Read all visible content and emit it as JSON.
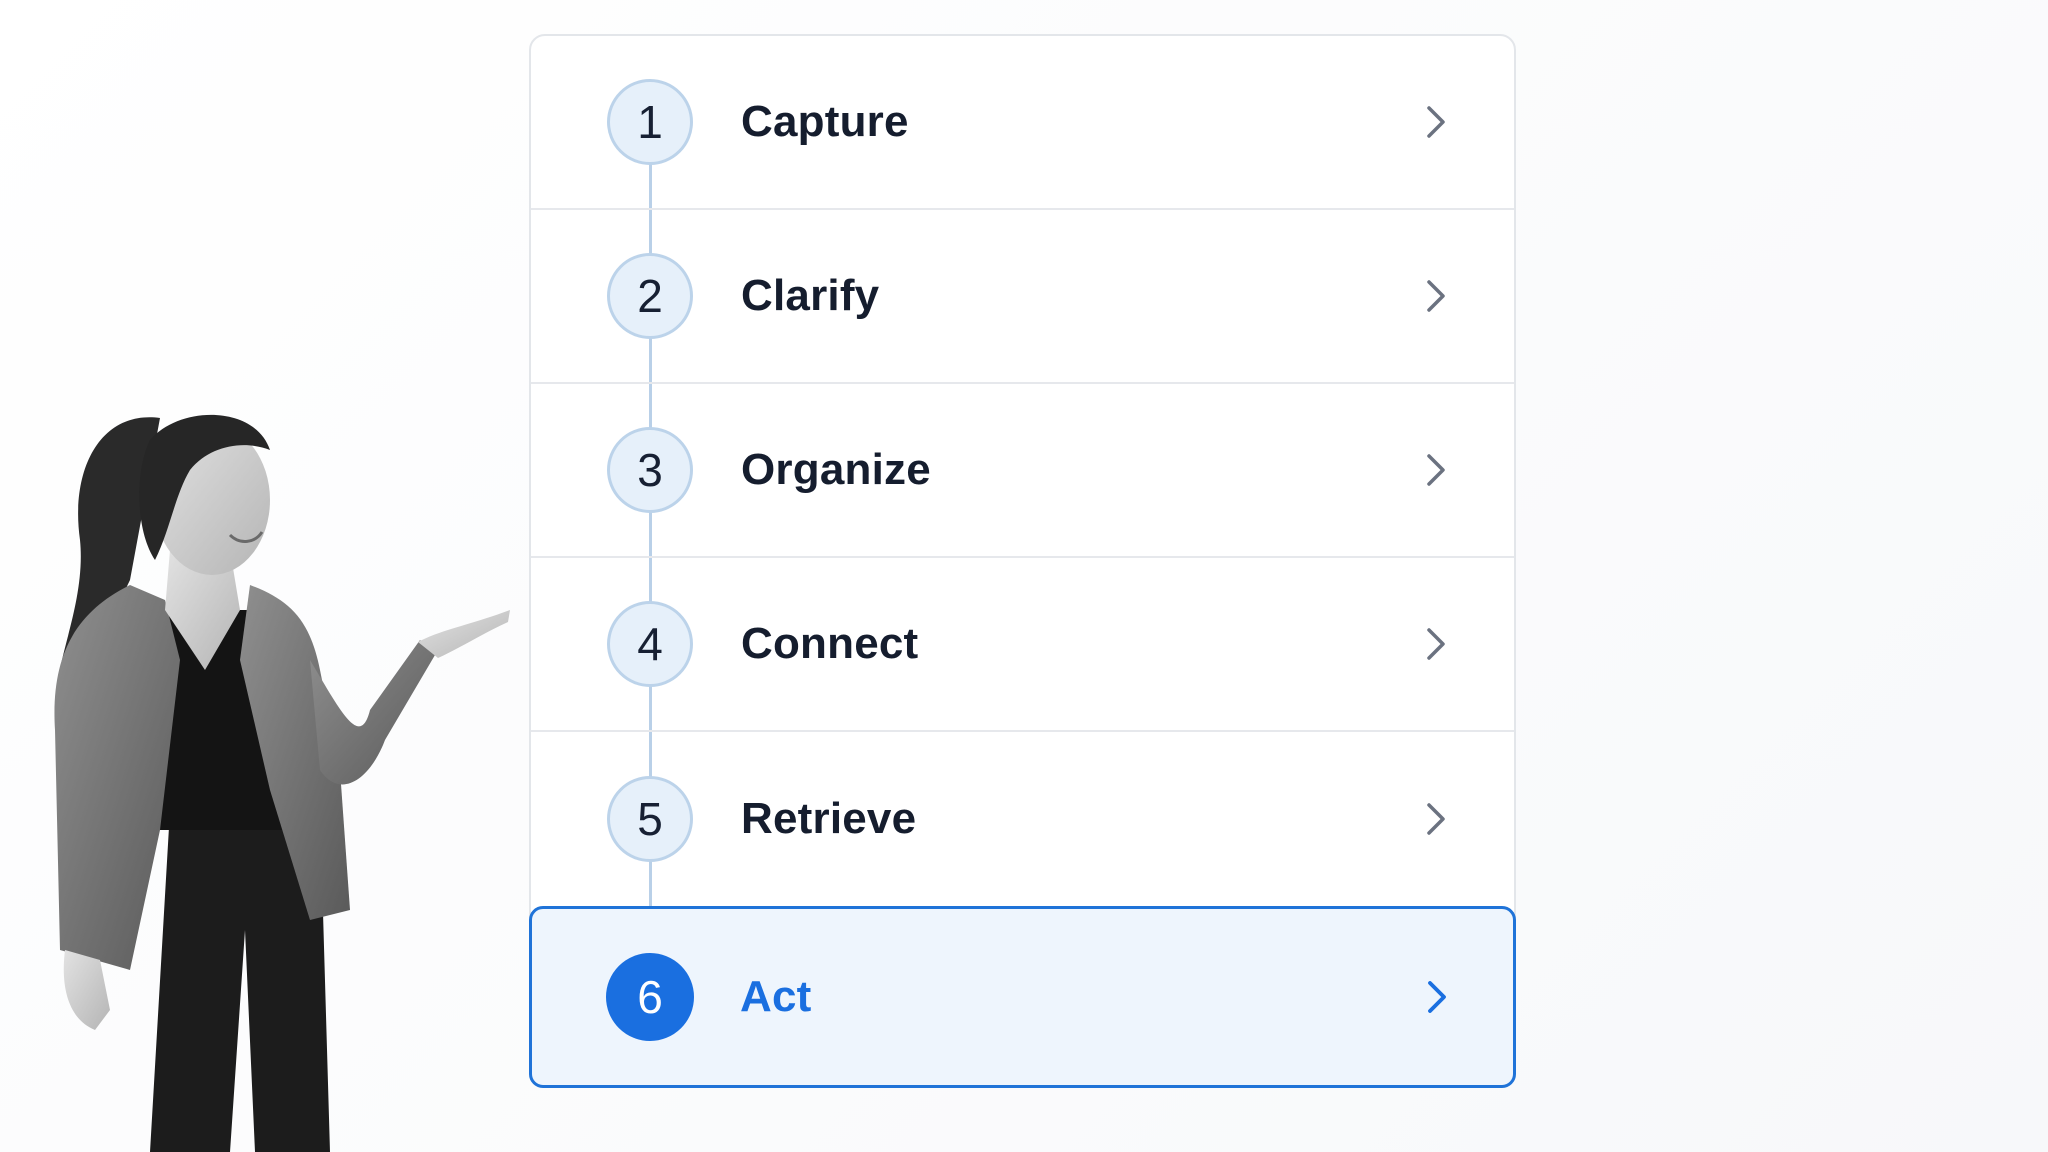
{
  "colors": {
    "accent": "#1a6fe0",
    "active_background": "#eef5fd",
    "badge_background": "#e6f0fa",
    "badge_border": "#bcd3ea",
    "text": "#151d2e",
    "divider": "#e6e8ec",
    "chevron": "#6b7280"
  },
  "steps": [
    {
      "number": "1",
      "label": "Capture",
      "icon": "chevron-right-icon"
    },
    {
      "number": "2",
      "label": "Clarify",
      "icon": "chevron-right-icon"
    },
    {
      "number": "3",
      "label": "Organize",
      "icon": "chevron-right-icon"
    },
    {
      "number": "4",
      "label": "Connect",
      "icon": "chevron-right-icon"
    },
    {
      "number": "5",
      "label": "Retrieve",
      "icon": "chevron-right-icon"
    },
    {
      "number": "6",
      "label": "Act",
      "icon": "chevron-right-icon",
      "active": true
    }
  ]
}
